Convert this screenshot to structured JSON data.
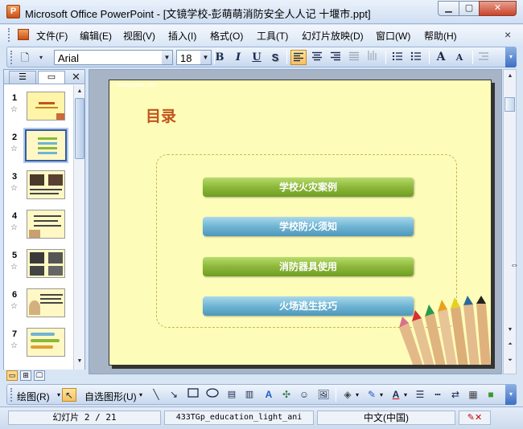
{
  "window": {
    "title": "Microsoft Office PowerPoint - [文镜学校-彭萌萌消防安全人人记 十堰市.ppt]",
    "app_icon_letter": "P",
    "minimize": "▁",
    "maximize": "▢",
    "close": "✕"
  },
  "menu": {
    "items": [
      "文件(F)",
      "编辑(E)",
      "视图(V)",
      "插入(I)",
      "格式(O)",
      "工具(T)",
      "幻灯片放映(D)",
      "窗口(W)",
      "帮助(H)"
    ],
    "close": "×"
  },
  "toolbar": {
    "font_name": "Arial",
    "font_size": "18",
    "bold": "B",
    "italic": "I",
    "underline": "U",
    "shadow": "S",
    "increase_font": "A",
    "decrease_font": "A"
  },
  "slides_pane": {
    "close": "✕",
    "slide_numbers": [
      "1",
      "2",
      "3",
      "4",
      "5",
      "6",
      "7"
    ],
    "selected_index": 2
  },
  "slide": {
    "watermark": "www.pptok.com",
    "title": "目录",
    "items": [
      "学校火灾案例",
      "学校防火须知",
      "消防器具使用",
      "火场逃生技巧"
    ],
    "item_colors": [
      "#8cb73a",
      "#6fb4d3",
      "#8cb73a",
      "#6fb4d3"
    ]
  },
  "drawbar": {
    "draw_label": "绘图(R)",
    "autoshapes_label": "自选图形(U)"
  },
  "status": {
    "slide": "幻灯片 2 / 21",
    "design": "433TGp_education_light_ani",
    "language": "中文(中国)"
  }
}
